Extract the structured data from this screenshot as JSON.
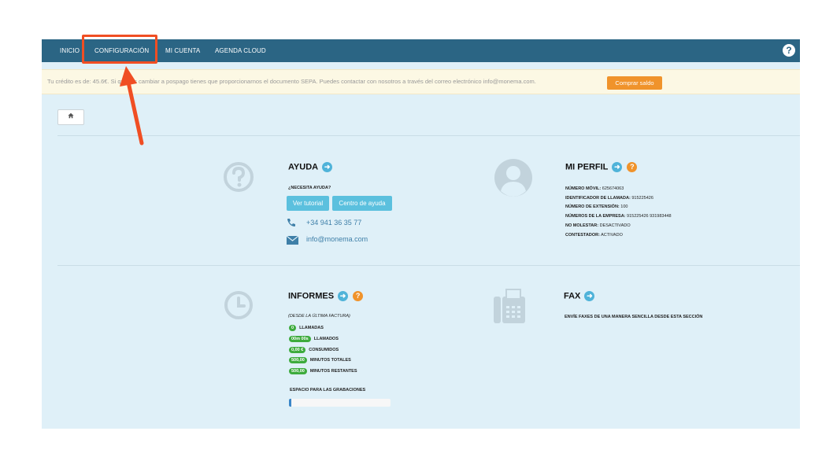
{
  "nav": {
    "items": [
      "INICIO",
      "CONFIGURACIÓN",
      "MI CUENTA",
      "AGENDA CLOUD"
    ],
    "help_label": "?"
  },
  "notice": {
    "text": "Tu crédito es de: 45.6€. Si quieres cambiar a pospago tienes que proporcionarnos el documento SEPA. Puedes contactar con nosotros a través del correo electrónico info@monema.com.",
    "button": "Comprar saldo"
  },
  "ayuda": {
    "title": "AYUDA",
    "subtitle": "¿NECESITA AYUDA?",
    "btn_tutorial": "Ver tutorial",
    "btn_centro": "Centro de ayuda",
    "phone": "+34 941 36 35 77",
    "email": "info@monema.com"
  },
  "perfil": {
    "title": "MI PERFIL",
    "lines": [
      {
        "label": "NÚMERO MÓVIL:",
        "value": "625674063"
      },
      {
        "label": "IDENTIFICADOR DE LLAMADA:",
        "value": "915225426"
      },
      {
        "label": "NÚMERO DE EXTENSIÓN:",
        "value": "100"
      },
      {
        "label": "NÚMEROS DE LA EMPRESA:",
        "value": "915225426 931983448"
      },
      {
        "label": "NO MOLESTAR:",
        "value": "DESACTIVADO"
      },
      {
        "label": "CONTESTADOR:",
        "value": "ACTIVADO"
      }
    ]
  },
  "informes": {
    "title": "INFORMES",
    "subtitle": "(DESDE LA ÚLTIMA FACTURA)",
    "stats": [
      {
        "badge": "0",
        "label": "LLAMADAS"
      },
      {
        "badge": "00m 00s",
        "label": "LLAMADOS"
      },
      {
        "badge": "0,00 €",
        "label": "CONSUMIDOS"
      },
      {
        "badge": "500,00",
        "label": "MINUTOS TOTALES"
      },
      {
        "badge": "500,00",
        "label": "MINUTOS RESTANTES"
      }
    ],
    "storage_label": "ESPACIO PARA LAS GRABACIONES",
    "storage_fraction": 0.02
  },
  "fax": {
    "title": "FAX",
    "desc": "ENVÍE FAXES DE UNA MANERA SENCILLA DESDE ESTA SECCIÓN"
  },
  "colors": {
    "navbar": "#2b6584",
    "content_bg": "#dff0f8",
    "accent_orange": "#f0932b",
    "accent_blue": "#5bc0de",
    "highlight_red": "#f04e23",
    "badge_green": "#3dab3d"
  },
  "icons": [
    "question-circle-icon",
    "user-icon",
    "clock-icon",
    "fax-icon",
    "phone-icon",
    "envelope-icon",
    "home-icon",
    "arrow-right-icon"
  ]
}
